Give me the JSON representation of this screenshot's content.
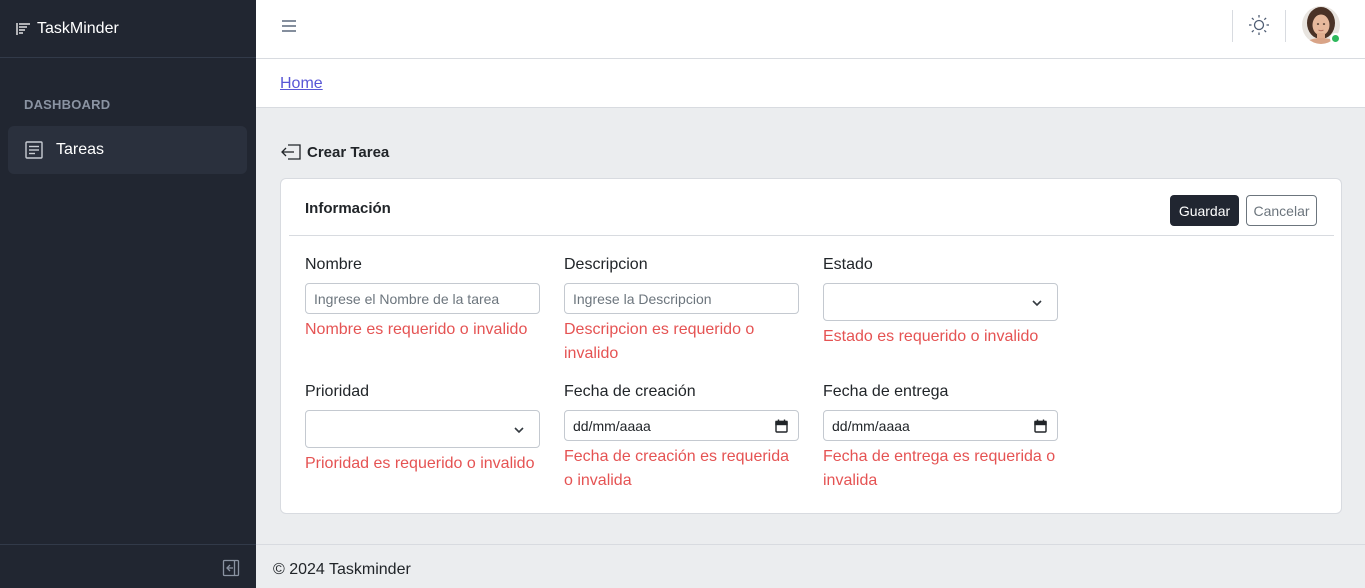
{
  "app": {
    "brand": "TaskMinder"
  },
  "sidebar": {
    "section_title": "DASHBOARD",
    "items": [
      {
        "label": "Tareas",
        "icon": "list-icon",
        "active": true
      }
    ]
  },
  "breadcrumb": {
    "home": "Home"
  },
  "page": {
    "title": "Crear Tarea"
  },
  "card": {
    "title": "Información",
    "save_label": "Guardar",
    "cancel_label": "Cancelar"
  },
  "form": {
    "nombre": {
      "label": "Nombre",
      "placeholder": "Ingrese el Nombre de la tarea",
      "error": "Nombre es requerido o invalido"
    },
    "descripcion": {
      "label": "Descripcion",
      "placeholder": "Ingrese la Descripcion",
      "error": "Descripcion es requerido o invalido"
    },
    "estado": {
      "label": "Estado",
      "value": "",
      "error": "Estado es requerido o invalido"
    },
    "prioridad": {
      "label": "Prioridad",
      "value": "",
      "error": "Prioridad es requerido o invalido"
    },
    "fecha_creacion": {
      "label": "Fecha de creación",
      "value": "dd/mm/aaaa",
      "error": "Fecha de creación es requerida o invalida"
    },
    "fecha_entrega": {
      "label": "Fecha de entrega",
      "value": "dd/mm/aaaa",
      "error": "Fecha de entrega es requerida o invalida"
    }
  },
  "footer": {
    "text": "© 2024 Taskminder"
  },
  "colors": {
    "sidebar_bg": "#212631",
    "primary_dark": "#212631",
    "error": "#e55353",
    "link": "#5856d6",
    "status_online": "#2eb85c"
  }
}
